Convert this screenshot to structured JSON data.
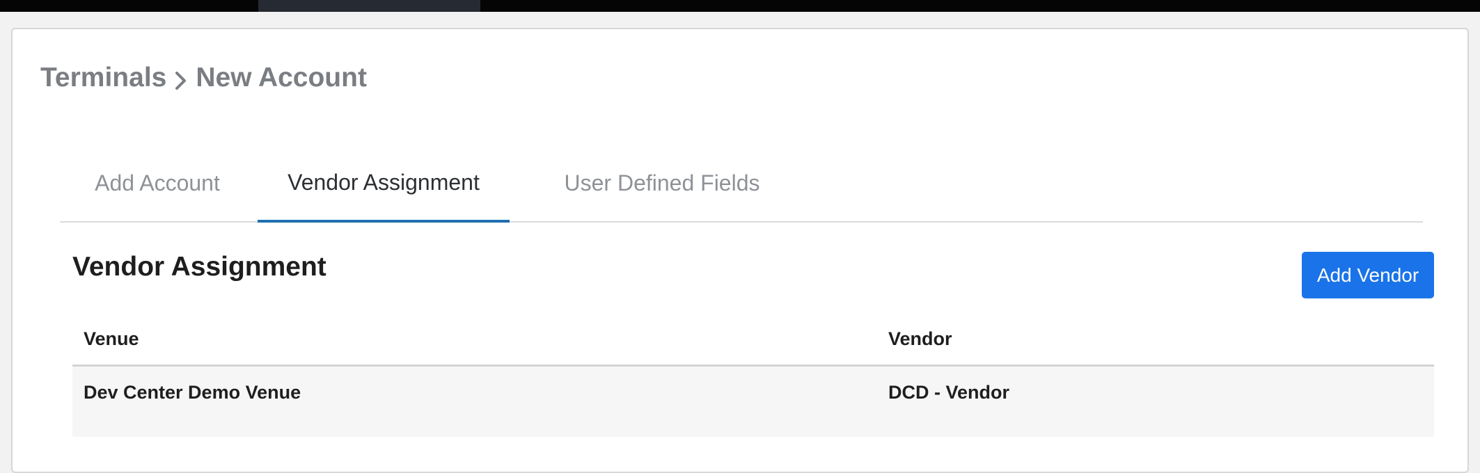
{
  "breadcrumb": {
    "parent": "Terminals",
    "current": "New Account"
  },
  "tabs": [
    {
      "label": "Add Account",
      "active": false
    },
    {
      "label": "Vendor Assignment",
      "active": true
    },
    {
      "label": "User Defined Fields",
      "active": false
    }
  ],
  "section": {
    "title": "Vendor Assignment",
    "add_button_label": "Add Vendor"
  },
  "table": {
    "columns": [
      "Venue",
      "Vendor"
    ],
    "rows": [
      [
        "Dev Center Demo Venue",
        "DCD - Vendor"
      ]
    ]
  },
  "colors": {
    "accent": "#1a73e8",
    "active_tab_underline": "#1f6fb2",
    "breadcrumb": "#7a7e83"
  },
  "icons": {
    "breadcrumb_separator": "chevron-right-icon"
  }
}
